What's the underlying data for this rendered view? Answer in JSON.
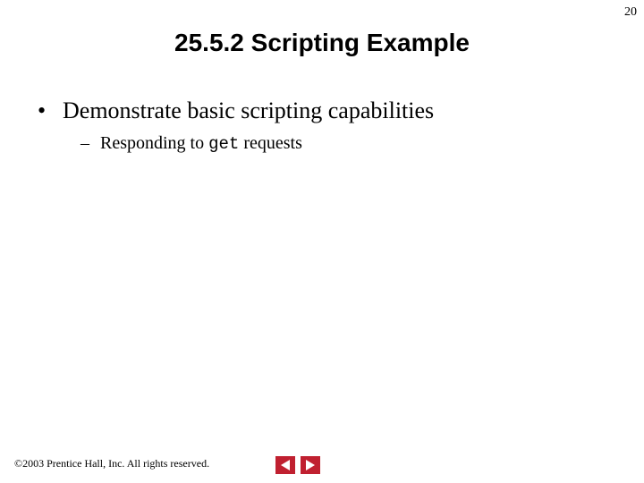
{
  "page_number": "20",
  "title": "25.5.2   Scripting Example",
  "bullets": {
    "l1": "Demonstrate basic scripting capabilities",
    "l2_pre": "Responding to ",
    "l2_code": "get",
    "l2_post": " requests"
  },
  "footer": {
    "copyright_symbol": "©",
    "text": " 2003 Prentice Hall, Inc.  All rights reserved."
  },
  "nav": {
    "prev_name": "prev-slide-button",
    "next_name": "next-slide-button"
  }
}
